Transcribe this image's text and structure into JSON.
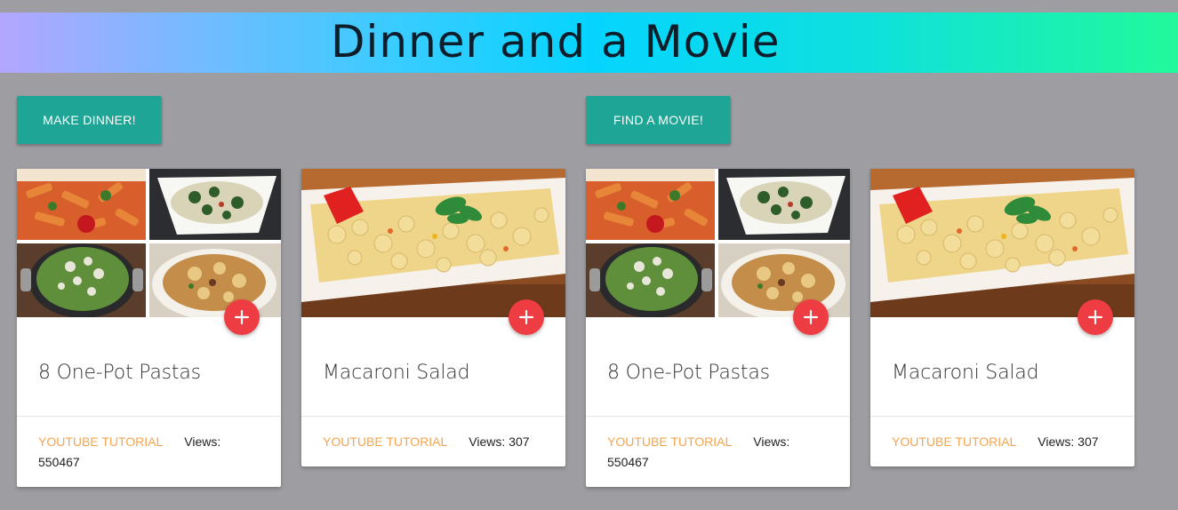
{
  "header": {
    "title": "Dinner and a Movie"
  },
  "buttons": {
    "make_dinner": "MAKE DINNER!",
    "find_movie": "FIND A MOVIE!"
  },
  "cards": [
    {
      "title": "8 One-Pot Pastas",
      "link_label": "YOUTUBE TUTORIAL",
      "views": "Views: 550467",
      "image": "four-pasta-collage"
    },
    {
      "title": "Macaroni Salad",
      "link_label": "YOUTUBE TUTORIAL",
      "views": "Views: 307",
      "image": "macaroni-salad-plate"
    },
    {
      "title": "8 One-Pot Pastas",
      "link_label": "YOUTUBE TUTORIAL",
      "views": "Views: 550467",
      "image": "four-pasta-collage"
    },
    {
      "title": "Macaroni Salad",
      "link_label": "YOUTUBE TUTORIAL",
      "views": "Views: 307",
      "image": "macaroni-salad-plate"
    }
  ],
  "colors": {
    "background": "#9e9ea2",
    "button": "#1fa595",
    "fab": "#ee3c43",
    "link": "#f7a44d"
  },
  "icons": {
    "fab": "plus-icon"
  }
}
